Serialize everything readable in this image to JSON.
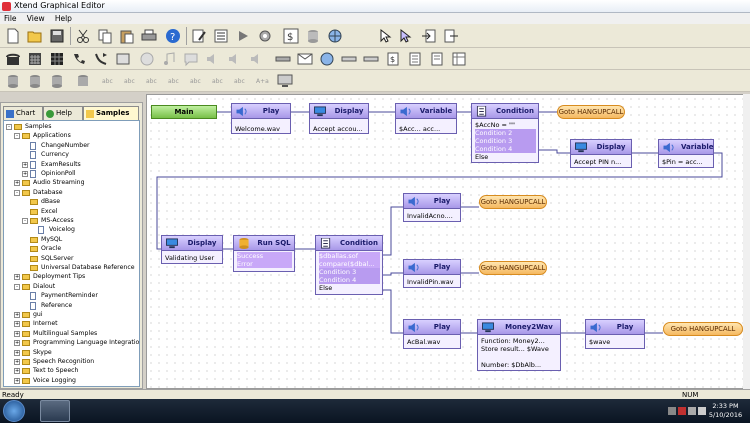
{
  "window": {
    "title": "Xtend Graphical Editor"
  },
  "menu": [
    "File",
    "View",
    "Help"
  ],
  "left_panel": {
    "tabs": [
      "Chart",
      "Help",
      "Samples"
    ],
    "active_tab": "Samples",
    "tree": [
      {
        "label": "Samples",
        "depth": 0,
        "type": "folder",
        "toggle": "-"
      },
      {
        "label": "Applications",
        "depth": 1,
        "type": "folder",
        "toggle": "-"
      },
      {
        "label": "ChangeNumber",
        "depth": 2,
        "type": "doc"
      },
      {
        "label": "Currency",
        "depth": 2,
        "type": "doc"
      },
      {
        "label": "ExamResults",
        "depth": 2,
        "type": "doc",
        "toggle": "+"
      },
      {
        "label": "OpinionPoll",
        "depth": 2,
        "type": "doc",
        "toggle": "+"
      },
      {
        "label": "Audio Streaming",
        "depth": 1,
        "type": "folder",
        "toggle": "+"
      },
      {
        "label": "Database",
        "depth": 1,
        "type": "folder",
        "toggle": "-"
      },
      {
        "label": "dBase",
        "depth": 2,
        "type": "folder"
      },
      {
        "label": "Excel",
        "depth": 2,
        "type": "folder"
      },
      {
        "label": "MS-Access",
        "depth": 2,
        "type": "folder",
        "toggle": "-"
      },
      {
        "label": "Voicelog",
        "depth": 3,
        "type": "doc"
      },
      {
        "label": "MySQL",
        "depth": 2,
        "type": "folder"
      },
      {
        "label": "Oracle",
        "depth": 2,
        "type": "folder"
      },
      {
        "label": "SQLServer",
        "depth": 2,
        "type": "folder"
      },
      {
        "label": "Universal Database Reference",
        "depth": 2,
        "type": "folder"
      },
      {
        "label": "Deployment Tips",
        "depth": 1,
        "type": "folder",
        "toggle": "+"
      },
      {
        "label": "Dialout",
        "depth": 1,
        "type": "folder",
        "toggle": "-"
      },
      {
        "label": "PaymentReminder",
        "depth": 2,
        "type": "doc"
      },
      {
        "label": "Reference",
        "depth": 2,
        "type": "doc"
      },
      {
        "label": "gui",
        "depth": 1,
        "type": "folder",
        "toggle": "+"
      },
      {
        "label": "Internet",
        "depth": 1,
        "type": "folder",
        "toggle": "+"
      },
      {
        "label": "Multilingual Samples",
        "depth": 1,
        "type": "folder",
        "toggle": "+"
      },
      {
        "label": "Programming Language Integration",
        "depth": 1,
        "type": "folder",
        "toggle": "+"
      },
      {
        "label": "Skype",
        "depth": 1,
        "type": "folder",
        "toggle": "+"
      },
      {
        "label": "Speech Recognition",
        "depth": 1,
        "type": "folder",
        "toggle": "+"
      },
      {
        "label": "Text to Speech",
        "depth": 1,
        "type": "folder",
        "toggle": "+"
      },
      {
        "label": "Voice Logging",
        "depth": 1,
        "type": "folder",
        "toggle": "+"
      }
    ]
  },
  "flow": {
    "main": "Main",
    "blocks": {
      "play1": {
        "title": "Play",
        "lines": [
          "Welcome.wav"
        ]
      },
      "display1": {
        "title": "Display",
        "lines": [
          "Accept accou..."
        ]
      },
      "variable1": {
        "title": "Variable",
        "lines": [
          "$Acc...     acc..."
        ]
      },
      "condition1": {
        "title": "Condition",
        "lines": [
          "$AccNo = \"\"",
          "Condition 2",
          "Condition 3",
          "Condition 4",
          "Else"
        ]
      },
      "display2": {
        "title": "Display",
        "lines": [
          "Accept PIN n..."
        ]
      },
      "variable2": {
        "title": "Variable",
        "lines": [
          "$Pin =   acc..."
        ]
      },
      "display3": {
        "title": "Display",
        "lines": [
          "Validating User"
        ]
      },
      "runsql": {
        "title": "Run SQL",
        "lines": [
          "Success",
          "Error"
        ]
      },
      "condition2": {
        "title": "Condition",
        "lines": [
          "$dballas.sof",
          "compare($dbal...",
          "Condition 3",
          "Condition 4",
          "Else"
        ]
      },
      "play2": {
        "title": "Play",
        "lines": [
          "InvalidAcno...."
        ]
      },
      "play3": {
        "title": "Play",
        "lines": [
          "InvalidPin.wav"
        ]
      },
      "play4": {
        "title": "Play",
        "lines": [
          "AcBal.wav"
        ]
      },
      "money": {
        "title": "Money2Wav",
        "lines": [
          "Function:  Money2...",
          "Store result...  $Wave",
          "",
          "Number:  $DbAlb..."
        ]
      },
      "play5": {
        "title": "Play",
        "lines": [
          "$wave"
        ]
      }
    },
    "gotos": [
      "Goto HANGUPCALL",
      "Goto HANGUPCALL",
      "Goto HANGUPCALL",
      "Goto HANGUPCALL"
    ]
  },
  "status": {
    "text": "Ready",
    "num": "NUM"
  },
  "taskbar": {
    "time": "2:33 PM",
    "date": "5/10/2016"
  }
}
